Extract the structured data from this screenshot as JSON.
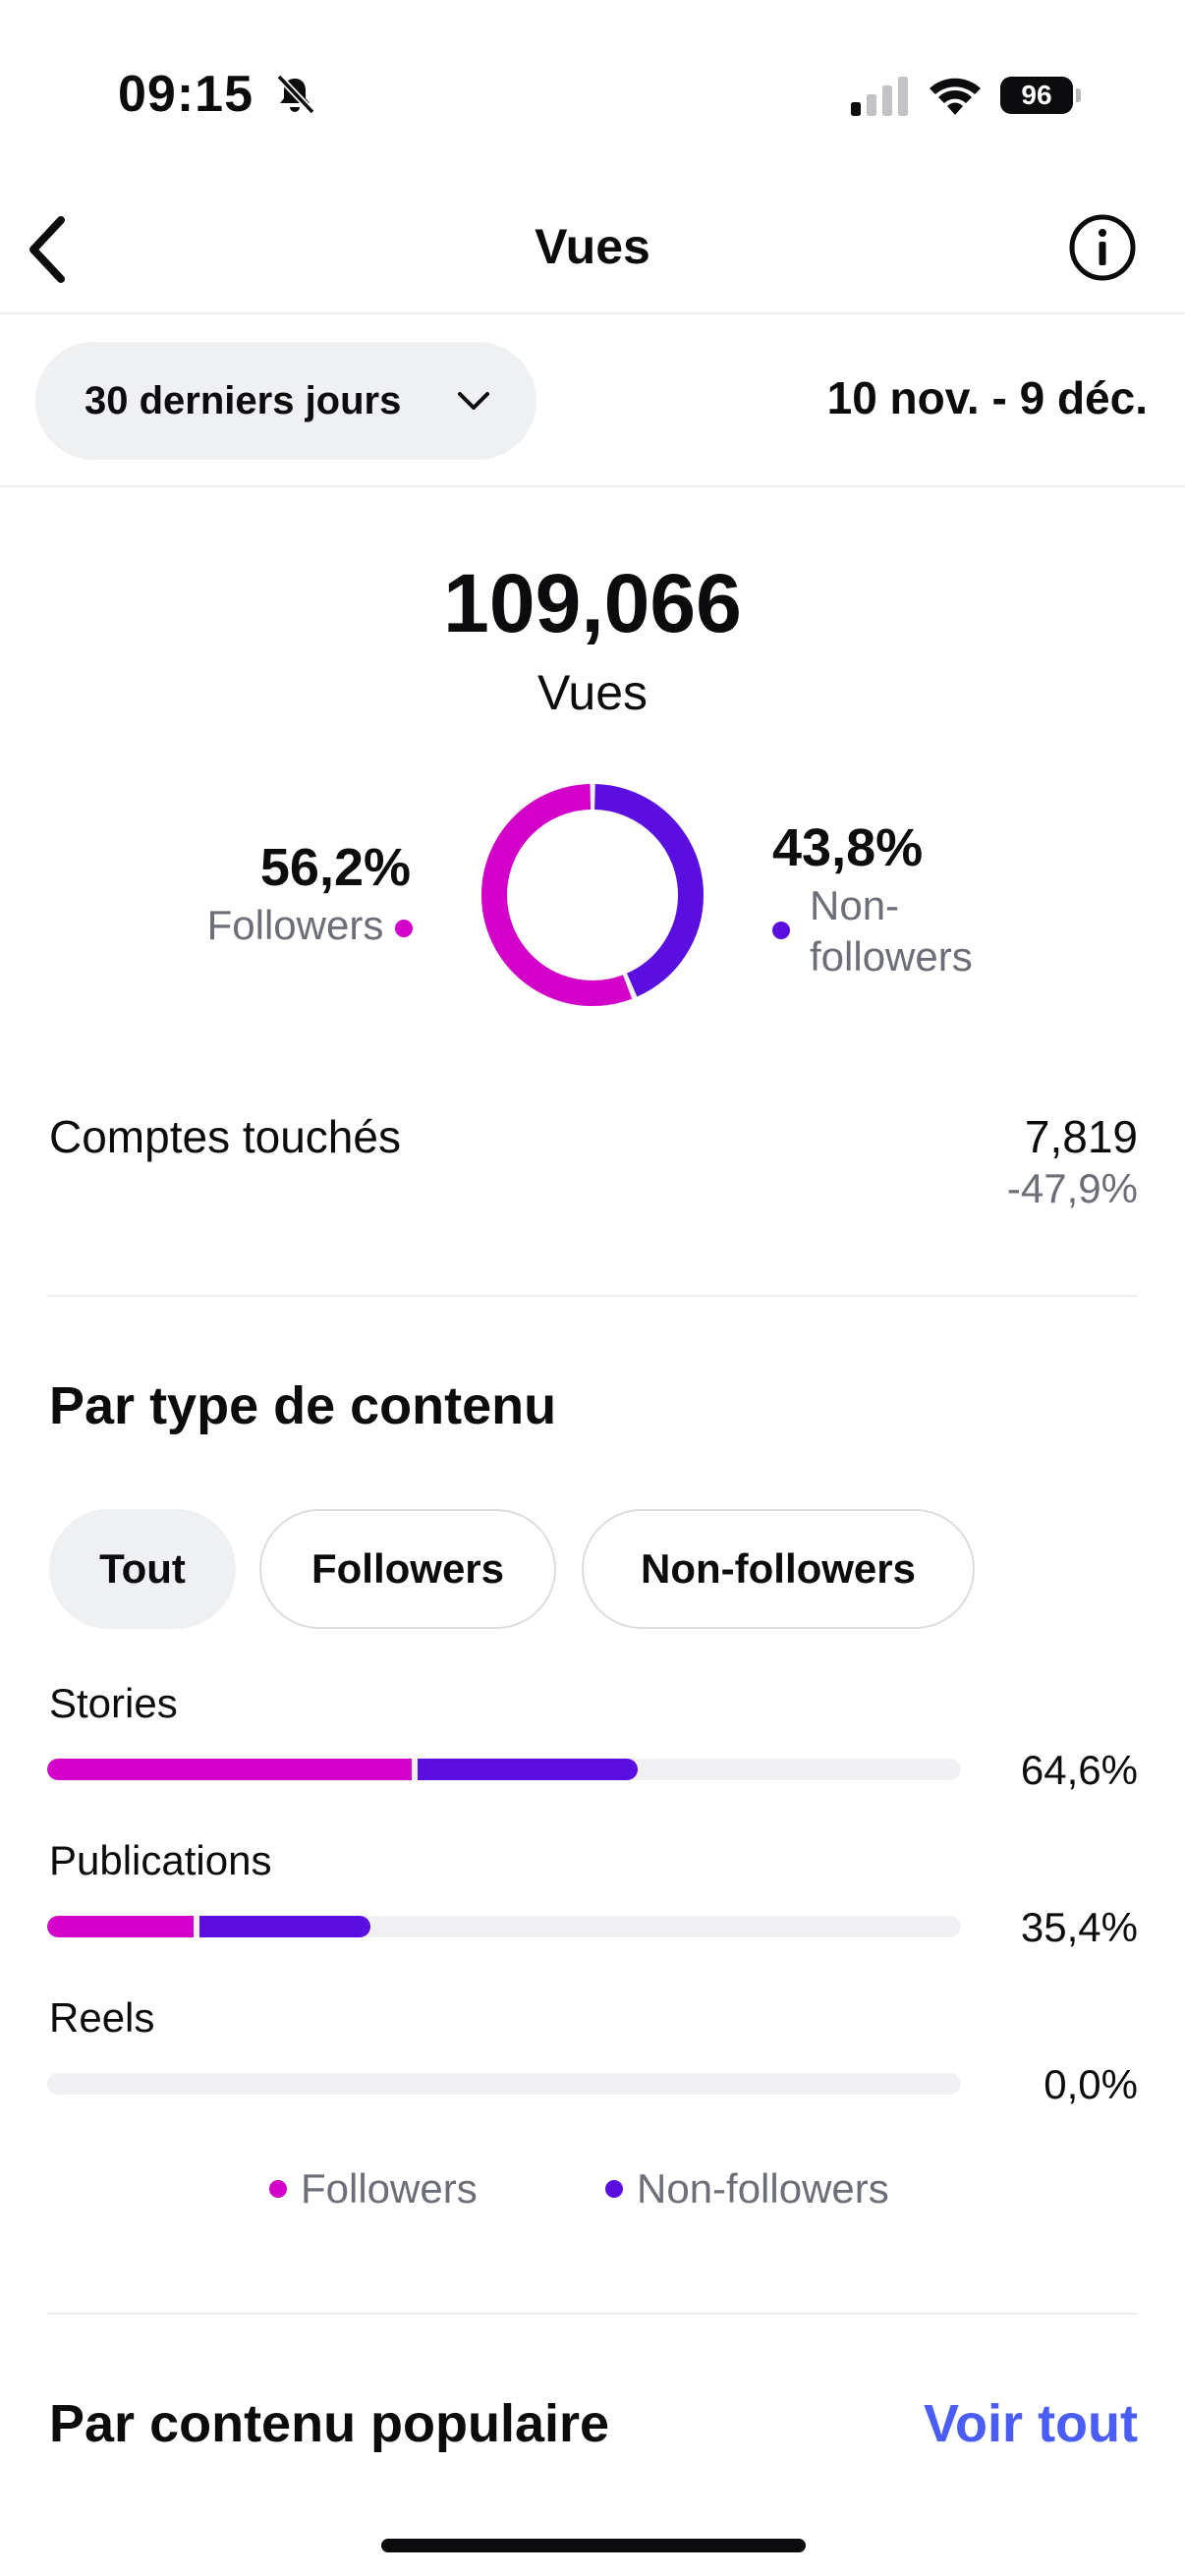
{
  "status_bar": {
    "time": "09:15",
    "battery": "96",
    "icons": [
      "bell-slash-icon",
      "cellular-signal-icon",
      "wifi-icon",
      "battery-icon"
    ]
  },
  "nav": {
    "title": "Vues",
    "back_icon": "chevron-left-icon",
    "info_icon": "info-circle-icon"
  },
  "range": {
    "selected": "30 derniers jours",
    "dates": "10 nov. - 9 déc."
  },
  "summary": {
    "total": "109,066",
    "total_label": "Vues",
    "followers_pct": "56,2%",
    "followers_label": "Followers",
    "non_followers_pct": "43,8%",
    "non_followers_label": "Non-followers",
    "followers_share": 0.562
  },
  "accounts_reached": {
    "label": "Comptes touchés",
    "value": "7,819",
    "change": "-47,9%"
  },
  "content_type": {
    "title": "Par type de contenu",
    "tabs": [
      "Tout",
      "Followers",
      "Non-followers"
    ],
    "active_tab": "Tout",
    "rows": [
      {
        "label": "Stories",
        "value": "64,6%",
        "followers_fraction": 0.399,
        "non_followers_fraction": 0.247
      },
      {
        "label": "Publications",
        "value": "35,4%",
        "followers_fraction": 0.16,
        "non_followers_fraction": 0.194
      },
      {
        "label": "Reels",
        "value": "0,0%",
        "followers_fraction": 0,
        "non_followers_fraction": 0
      }
    ],
    "legend": [
      "Followers",
      "Non-followers"
    ]
  },
  "popular": {
    "title": "Par contenu populaire",
    "see_all": "Voir tout"
  },
  "colors": {
    "followers": "#d200c8",
    "non_followers": "#5a0fe0",
    "link": "#4a5df6",
    "muted": "#6c6f78"
  }
}
